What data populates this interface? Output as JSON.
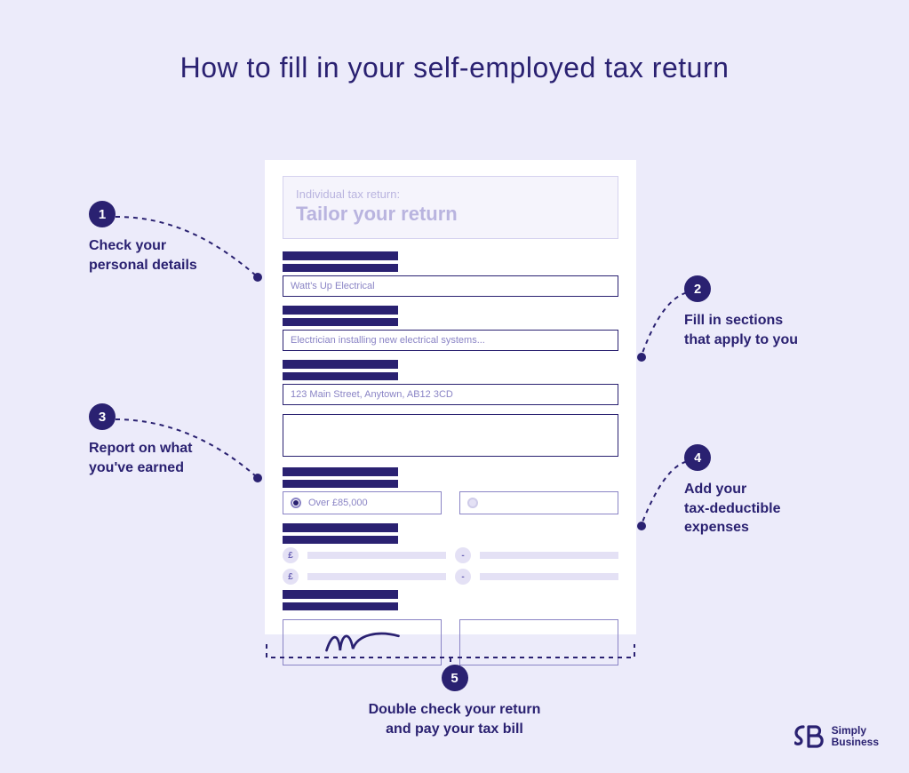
{
  "title": "How to fill in your self-employed tax return",
  "form": {
    "header_sub": "Individual tax return:",
    "header_main": "Tailor your return",
    "business_name": "Watt's Up Electrical",
    "description": "Electrician installing new electrical systems...",
    "address": "123 Main Street, Anytown, AB12 3CD",
    "radio_selected_label": "Over £85,000",
    "currency_symbol": "£",
    "minus_symbol": "-"
  },
  "steps": {
    "s1": {
      "num": "1",
      "text": "Check your\npersonal details"
    },
    "s2": {
      "num": "2",
      "text": "Fill in sections\nthat apply to you"
    },
    "s3": {
      "num": "3",
      "text": "Report on what\nyou've earned"
    },
    "s4": {
      "num": "4",
      "text": "Add your\ntax-deductible\nexpenses"
    },
    "s5": {
      "num": "5",
      "text": "Double check your return\nand pay your tax bill"
    }
  },
  "brand": {
    "initials": "SB",
    "name_line1": "Simply",
    "name_line2": "Business"
  }
}
